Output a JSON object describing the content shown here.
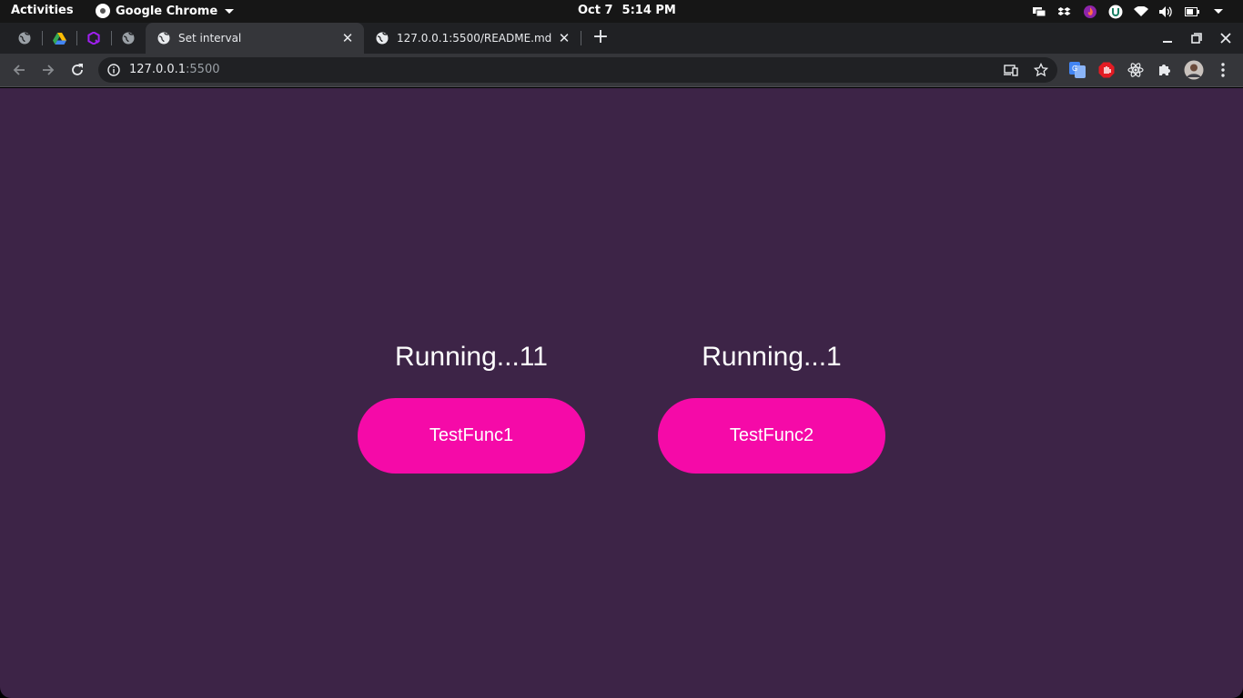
{
  "topbar": {
    "activities": "Activities",
    "app_name": "Google Chrome",
    "date": "Oct 7",
    "time": "5:14 PM",
    "tray_icons": [
      "display-icon",
      "dropbox-icon",
      "firefox-flame-icon",
      "u-app-icon",
      "wifi-icon",
      "volume-icon",
      "battery-icon",
      "system-menu-caret-icon"
    ]
  },
  "tabs": {
    "pinned": [
      "globe-icon",
      "google-drive-icon",
      "purple-app-icon",
      "globe-icon"
    ],
    "open": [
      {
        "title": "Set interval",
        "active": true,
        "favicon": "globe-icon"
      },
      {
        "title": "127.0.0.1:5500/README.md",
        "active": false,
        "favicon": "globe-icon"
      }
    ]
  },
  "toolbar": {
    "url_host": "127.0.0.1",
    "url_port": ":5500",
    "extensions": [
      "translate-extension-icon",
      "adblock-extension-icon",
      "react-devtools-icon",
      "extensions-puzzle-icon",
      "profile-avatar",
      "chrome-menu-icon"
    ]
  },
  "page": {
    "left": {
      "status": "Running...11",
      "button": "TestFunc1"
    },
    "right": {
      "status": "Running...1",
      "button": "TestFunc2"
    }
  },
  "colors": {
    "page_bg": "#3d2447",
    "button_bg": "#f50aa8",
    "text": "#ffffff"
  }
}
